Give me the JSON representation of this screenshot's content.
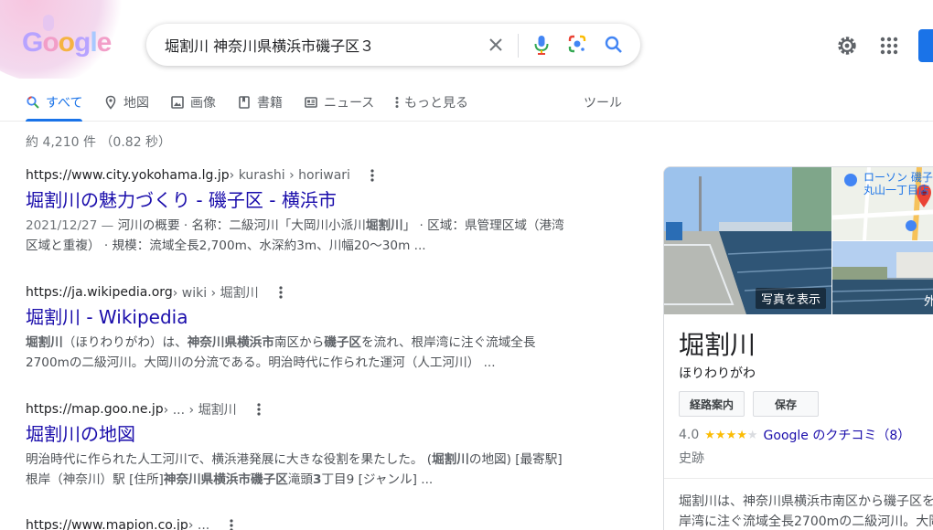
{
  "header": {
    "logo_text": "Google",
    "search": {
      "value": "堀割川 神奈川県横浜市磯子区３"
    }
  },
  "tabs": [
    {
      "label": "すべて",
      "icon": "search-icon"
    },
    {
      "label": "地図",
      "icon": "map-pin-icon"
    },
    {
      "label": "画像",
      "icon": "image-icon"
    },
    {
      "label": "書籍",
      "icon": "book-icon"
    },
    {
      "label": "ニュース",
      "icon": "news-icon"
    },
    {
      "label": "もっと見る",
      "icon": "more-vert-icon"
    }
  ],
  "tools_label": "ツール",
  "stats": "約 4,210 件 （0.82 秒）",
  "results": [
    {
      "url": "https://www.city.yokohama.lg.jp",
      "path": " › kurashi › horiwari",
      "title": "堀割川の魅力づくり - 磯子区 - 横浜市",
      "date": "2021/12/27 — ",
      "line1": "河川の概要 · 名称：二級河川「大岡川小派川",
      "line1_bold": "堀割川",
      "line1_tail": "」 · 区域：県管理区域（港湾",
      "line2": "区域と重複） · 規模：流域全長2,700m、水深約3m、川幅20〜30m ..."
    },
    {
      "url": "https://ja.wikipedia.org",
      "path": " › wiki › 堀割川",
      "title": "堀割川 - Wikipedia",
      "l1_b1": "堀割川",
      "l1_t1": "（ほりわりがわ）は、",
      "l1_b2": "神奈川県横浜市",
      "l1_t2": "南区から",
      "l1_b3": "磯子区",
      "l1_t3": "を流れ、根岸湾に注ぐ流域全長",
      "line2": "2700mの二級河川。大岡川の分流である。明治時代に作られた運河（人工河川） ..."
    },
    {
      "url": "https://map.goo.ne.jp",
      "path": " › ... › 堀割川",
      "title": "堀割川の地図",
      "l1_t1": "明治時代に作られた人工河川で、横浜港発展に大きな役割を果たした。 (",
      "l1_b1": "堀割川",
      "l1_t2": "の地図) [最寄駅]",
      "l2_t1": "根岸（神奈川）駅 [住所]",
      "l2_b1": "神奈川県横浜市磯子区",
      "l2_t2": "滝頭",
      "l2_b2": "3",
      "l2_t3": "丁目9 [ジャンル] ..."
    },
    {
      "url": "https://www.mapion.co.jp",
      "path": " › ..."
    }
  ],
  "knowledge_panel": {
    "photo_label": "写真を表示",
    "side_label": "外",
    "map_poi": "ローソン 磯子\n丸山一丁目店",
    "title": "堀割川",
    "reading": "ほりわりがわ",
    "btn_directions": "経路案内",
    "btn_save": "保存",
    "rating": "4.0",
    "reviews": "Google のクチコミ（8）",
    "type": "史跡",
    "desc_line1": "堀割川は、神奈川県横浜市南区から磯子区を",
    "desc_line2": "岸湾に注ぐ流域全長2700mの二級河川。大岡"
  }
}
